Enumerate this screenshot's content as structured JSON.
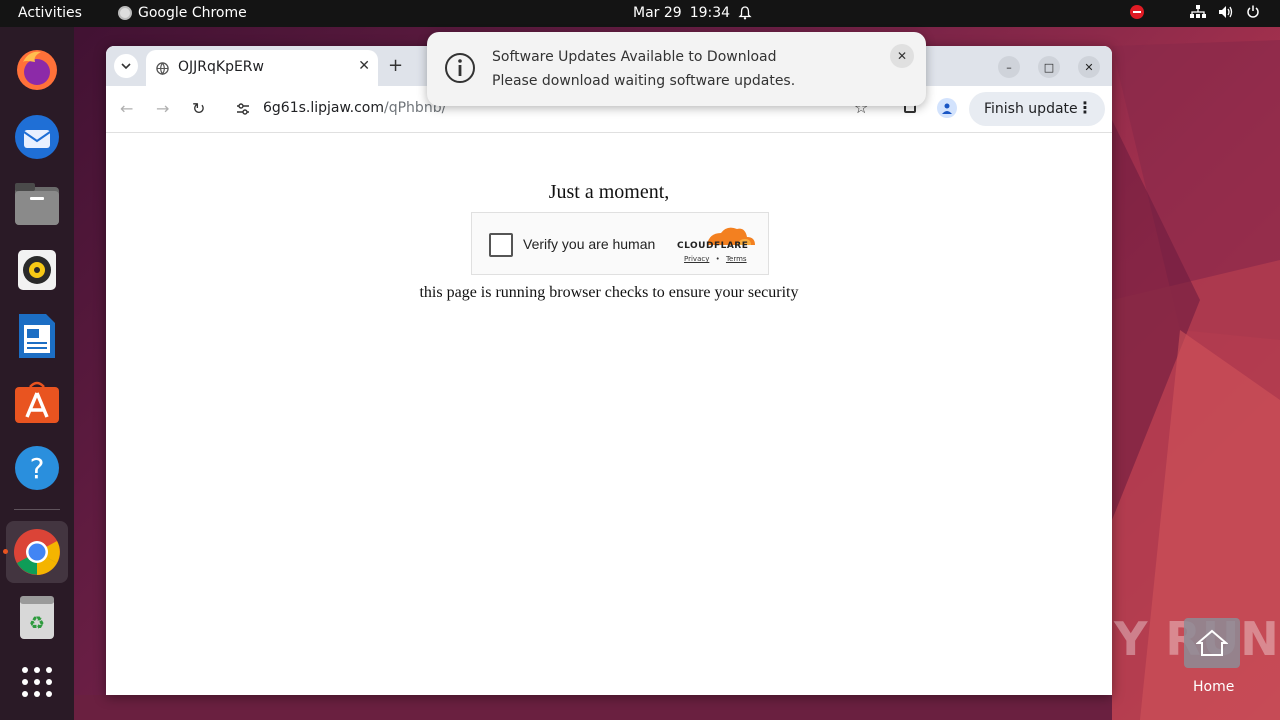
{
  "topbar": {
    "activities": "Activities",
    "app_name": "Google Chrome",
    "date": "Mar 29",
    "time": "19:34"
  },
  "dock": {
    "items": [
      "firefox-icon",
      "thunderbird-icon",
      "files-icon",
      "rhythmbox-icon",
      "writer-icon",
      "app-center-icon",
      "help-icon",
      "chrome-icon",
      "trash-icon",
      "show-apps-icon"
    ]
  },
  "browser": {
    "tab_title": "OJJRqKpERw",
    "url_host": "6g61s.lipjaw.com",
    "url_path": "/qPhbnb/",
    "finish_update_label": "Finish update"
  },
  "page": {
    "heading": "Just a moment,",
    "captcha_label": "Verify you are human",
    "captcha_brand": "CLOUDFLARE",
    "captcha_privacy": "Privacy",
    "captcha_sep": "•",
    "captcha_terms": "Terms",
    "subtext": "this page is running browser checks to ensure your security"
  },
  "notification": {
    "title": "Software Updates Available to Download",
    "body": "Please download waiting software updates."
  },
  "desktop": {
    "watermark": "ANY RUN",
    "home_label": "Home"
  },
  "colors": {
    "accent": "#e95420",
    "cloudflare_orange": "#f38020"
  }
}
